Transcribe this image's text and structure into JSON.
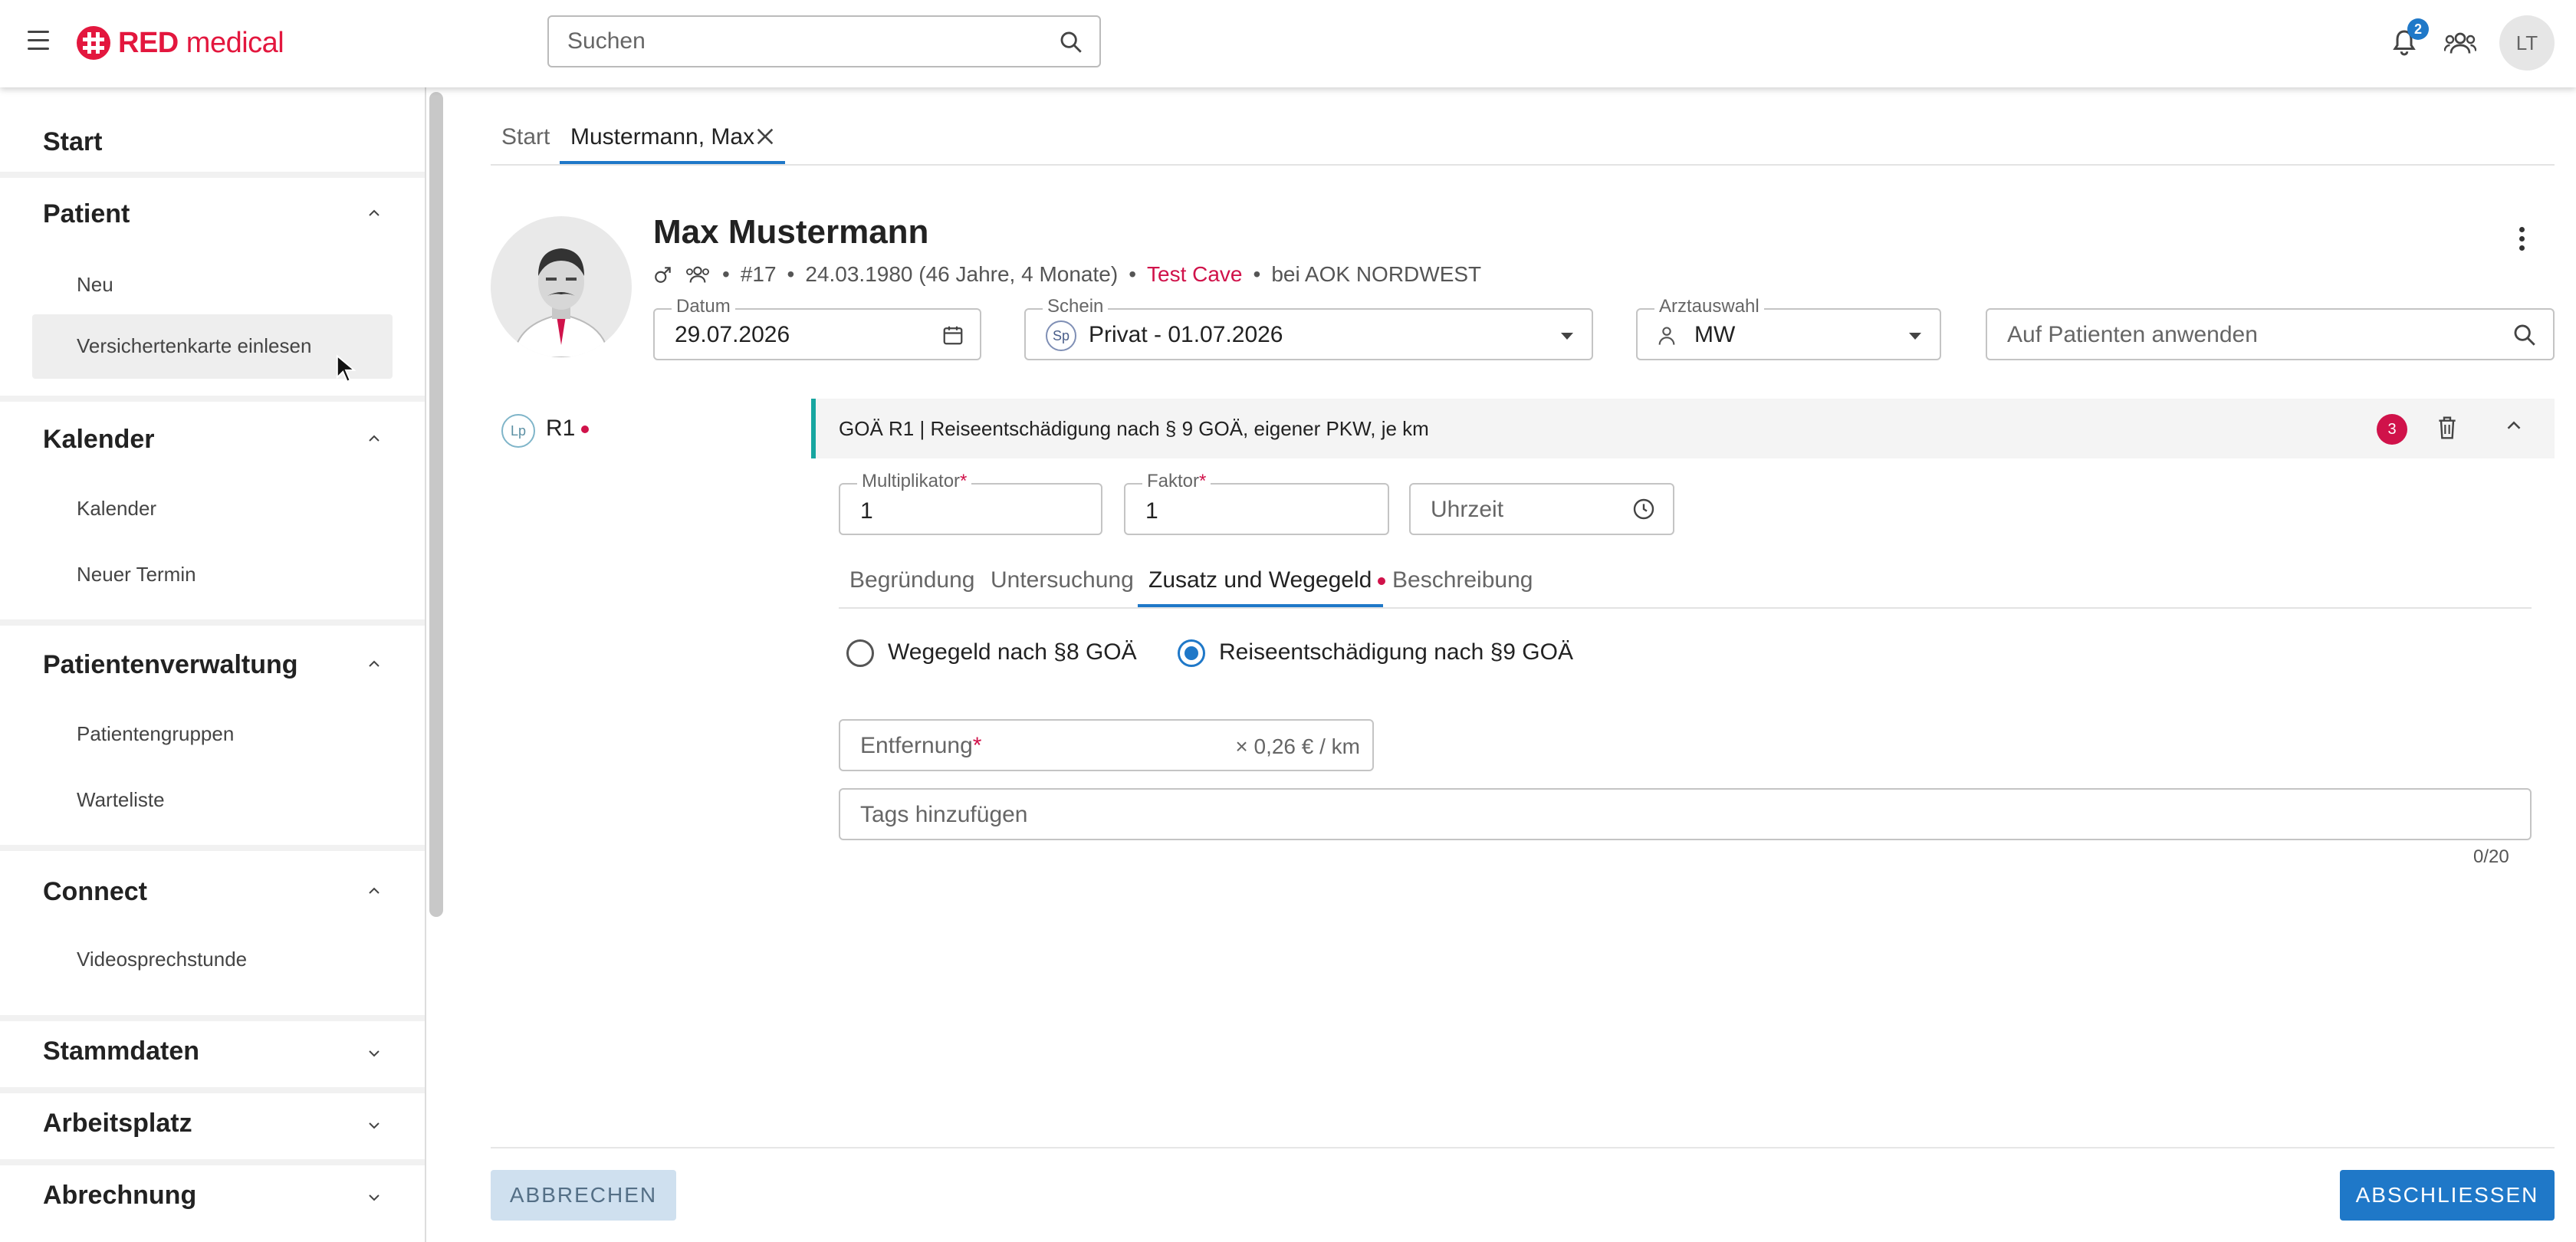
{
  "app": {
    "brand_prefix": "RED",
    "brand_suffix": " medical",
    "search_placeholder": "Suchen",
    "notification_count": "2",
    "user_initials": "LT",
    "accent_color": "#1f78c8",
    "brand_color": "#e3173e"
  },
  "sidebar": {
    "start": "Start",
    "sections": [
      {
        "title": "Patient",
        "items": [
          "Neu",
          "Versichertenkarte einlesen"
        ]
      },
      {
        "title": "Kalender",
        "items": [
          "Kalender",
          "Neuer Termin"
        ]
      },
      {
        "title": "Patientenverwaltung",
        "items": [
          "Patientengruppen",
          "Warteliste"
        ]
      },
      {
        "title": "Connect",
        "items": [
          "Videosprechstunde"
        ]
      },
      {
        "title": "Stammdaten",
        "items": []
      },
      {
        "title": "Arbeitsplatz",
        "items": []
      },
      {
        "title": "Abrechnung",
        "items": []
      }
    ]
  },
  "tabs": {
    "start": "Start",
    "active": "Mustermann, Max"
  },
  "patient": {
    "name": "Max Mustermann",
    "number": "#17",
    "birth": "24.03.1980 (46 Jahre, 4 Monate)",
    "cave": "Test Cave",
    "insurance": "bei AOK NORDWEST",
    "separator": "•"
  },
  "form": {
    "datum_label": "Datum",
    "datum_value": "29.07.2026",
    "schein_label": "Schein",
    "schein_badge": "Sp",
    "schein_value": "Privat - 01.07.2026",
    "arzt_label": "Arztauswahl",
    "arzt_value": "MW",
    "apply_placeholder": "Auf Patienten anwenden"
  },
  "entry": {
    "lp_badge": "Lp",
    "code": "R1",
    "title": "GOÄ R1 | Reiseentschädigung nach § 9 GOÄ, eigener PKW, je km",
    "count": "3",
    "multiplikator_label": "Multiplikator",
    "multiplikator_value": "1",
    "faktor_label": "Faktor",
    "faktor_value": "1",
    "uhrzeit_placeholder": "Uhrzeit",
    "required_mark": "*",
    "subtabs": [
      "Begründung",
      "Untersuchung",
      "Zusatz und Wegegeld",
      "Beschreibung"
    ],
    "active_subtab": "Zusatz und Wegegeld",
    "radio_options": [
      "Wegegeld nach §8 GOÄ",
      "Reiseentschädigung nach §9 GOÄ"
    ],
    "selected_radio": "Reiseentschädigung nach §9 GOÄ",
    "entfernung_label": "Entfernung",
    "entfernung_suffix": "× 0,26 € / km",
    "tags_placeholder": "Tags hinzufügen",
    "tags_counter": "0/20"
  },
  "footer": {
    "cancel": "ABBRECHEN",
    "finish": "ABSCHLIESSEN"
  }
}
